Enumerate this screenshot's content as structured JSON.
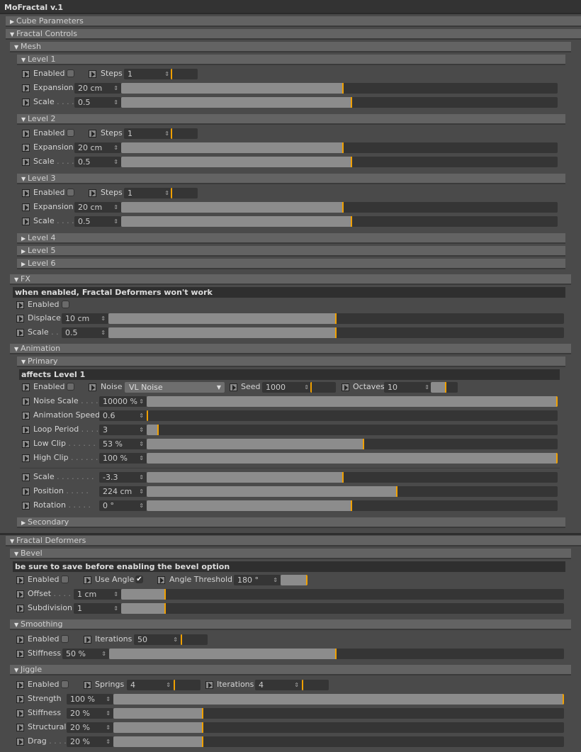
{
  "title": "MoFractal v.1",
  "sections": {
    "cube": "Cube Parameters",
    "fractal": "Fractal Controls",
    "mesh": "Mesh",
    "level1": "Level 1",
    "level2": "Level 2",
    "level3": "Level 3",
    "level4": "Level 4",
    "level5": "Level 5",
    "level6": "Level 6",
    "fx": "FX",
    "animation": "Animation",
    "primary": "Primary",
    "secondary": "Secondary",
    "deformers": "Fractal Deformers",
    "bevel": "Bevel",
    "smoothing": "Smoothing",
    "jiggle": "Jiggle"
  },
  "notes": {
    "fx": "when enabled, Fractal Deformers won't work",
    "primary": "affects Level 1",
    "bevel": "be sure to save before enabling the bevel option"
  },
  "labels": {
    "enabled": "Enabled",
    "steps": "Steps",
    "expansion": "Expansion",
    "scale": "Scale",
    "displace": "Displace",
    "noise": "Noise",
    "seed": "Seed",
    "octaves": "Octaves",
    "noise_scale": "Noise Scale",
    "anim_speed": "Animation Speed",
    "loop_period": "Loop Period",
    "low_clip": "Low Clip",
    "high_clip": "High Clip",
    "position": "Position",
    "rotation": "Rotation",
    "use_angle": "Use Angle",
    "angle_threshold": "Angle Threshold",
    "offset": "Offset",
    "subdivision": "Subdivision",
    "iterations": "Iterations",
    "stiffness": "Stiffness",
    "springs": "Springs",
    "strength": "Strength",
    "structural": "Structural",
    "drag": "Drag"
  },
  "levels": [
    {
      "steps": "1",
      "expansion": "20 cm",
      "expansion_pct": 0.51,
      "scale": "0.5",
      "scale_pct": 0.53
    },
    {
      "steps": "1",
      "expansion": "20 cm",
      "expansion_pct": 0.51,
      "scale": "0.5",
      "scale_pct": 0.53
    },
    {
      "steps": "1",
      "expansion": "20 cm",
      "expansion_pct": 0.51,
      "scale": "0.5",
      "scale_pct": 0.53
    }
  ],
  "fx": {
    "displace": "10 cm",
    "displace_pct": 0.5,
    "scale": "0.5",
    "scale_pct": 0.5
  },
  "primary": {
    "noise": "VL Noise",
    "seed": "1000",
    "octaves": "10",
    "noise_scale": "10000 %",
    "noise_scale_pct": 1.0,
    "anim_speed": "0.6",
    "anim_speed_pct": 0.0,
    "loop_period": "3",
    "loop_period_pct": 0.03,
    "low_clip": "53 %",
    "low_clip_pct": 0.53,
    "high_clip": "100 %",
    "high_clip_pct": 1.0,
    "scale": "-3.3",
    "scale_pct": 0.48,
    "position": "224 cm",
    "position_pct": 0.61,
    "rotation": "0 °",
    "rotation_pct": 0.5
  },
  "bevel": {
    "angle_threshold": "180 °",
    "offset": "1 cm",
    "offset_pct": 0.1,
    "subdivision": "1",
    "subdivision_pct": 0.1
  },
  "smoothing": {
    "iterations": "50",
    "stiffness": "50 %",
    "stiffness_pct": 0.5
  },
  "jiggle": {
    "springs": "4",
    "iterations": "4",
    "strength": "100 %",
    "strength_pct": 1.0,
    "stiffness": "20 %",
    "stiffness_pct": 0.2,
    "structural": "20 %",
    "structural_pct": 0.2,
    "drag": "20 %",
    "drag_pct": 0.2
  },
  "colors": {
    "accent": "#f0a000"
  }
}
